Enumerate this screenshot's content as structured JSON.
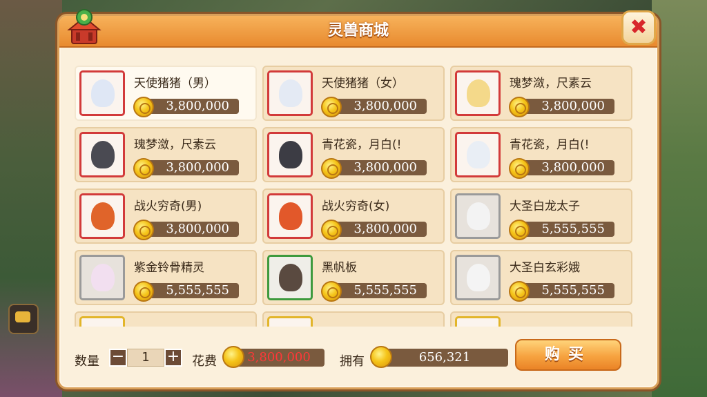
{
  "shop": {
    "title": "灵兽商城",
    "close_label": "✖"
  },
  "items": [
    {
      "name": "天使猪猪（男）",
      "price": "3,800,000",
      "frame": "red",
      "selected": true
    },
    {
      "name": "天使猪猪（女）",
      "price": "3,800,000",
      "frame": "red"
    },
    {
      "name": "瑰梦潋，尺素云",
      "price": "3,800,000",
      "frame": "red"
    },
    {
      "name": "瑰梦潋，尺素云",
      "price": "3,800,000",
      "frame": "red"
    },
    {
      "name": "青花瓷，月白(!",
      "price": "3,800,000",
      "frame": "red"
    },
    {
      "name": "青花瓷，月白(!",
      "price": "3,800,000",
      "frame": "red"
    },
    {
      "name": "战火穷奇(男)",
      "price": "3,800,000",
      "frame": "red"
    },
    {
      "name": "战火穷奇(女)",
      "price": "3,800,000",
      "frame": "red"
    },
    {
      "name": "大圣白龙太子",
      "price": "5,555,555",
      "frame": "gray"
    },
    {
      "name": "紫金铃骨精灵",
      "price": "5,555,555",
      "frame": "gray"
    },
    {
      "name": "黑帆板",
      "price": "5,555,555",
      "frame": "green"
    },
    {
      "name": "大圣白玄彩娥",
      "price": "5,555,555",
      "frame": "gray"
    }
  ],
  "footer": {
    "qty_label": "数量",
    "qty_minus": "−",
    "qty_value": "1",
    "qty_plus": "+",
    "cost_label": "花费",
    "cost_value": "3,800,000",
    "own_label": "拥有",
    "own_value": "656,321",
    "buy_label": "购买"
  },
  "colors": {
    "accent": "#e88a2f",
    "cost_text": "#ff3030",
    "price_bar": "#7a5a3e"
  }
}
